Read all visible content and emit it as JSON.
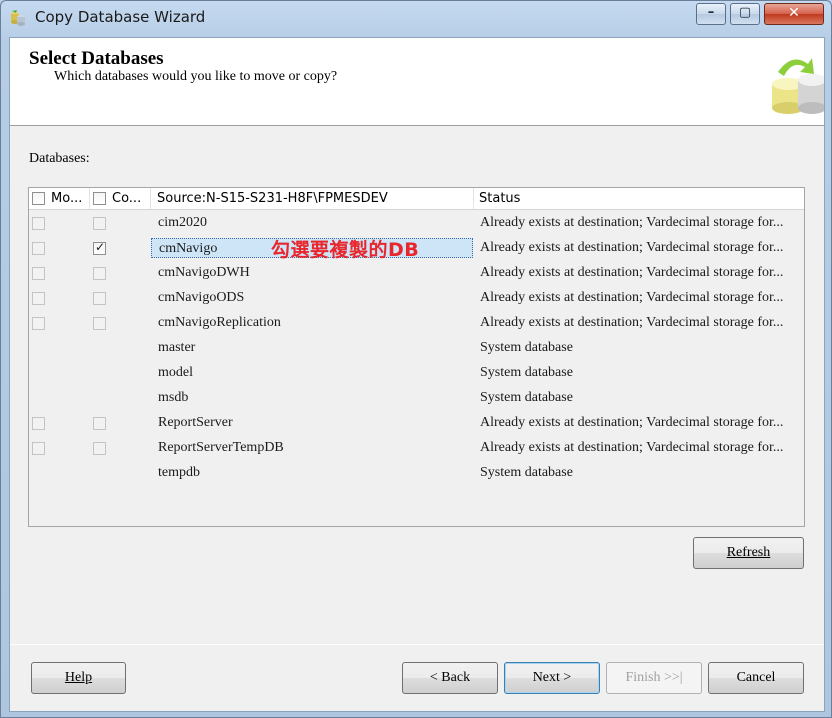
{
  "window": {
    "title": "Copy Database Wizard"
  },
  "header": {
    "title": "Select Databases",
    "subtitle": "Which databases would you like to move or copy?"
  },
  "databases_label": "Databases:",
  "grid": {
    "columns": [
      "Mo...",
      "Co...",
      "Source:N-S15-S231-H8F\\FPMESDEV",
      "Status"
    ],
    "rows": [
      {
        "move": false,
        "copy": false,
        "has_checks": true,
        "name": "cim2020",
        "status": "Already exists at destination; Vardecimal storage for..."
      },
      {
        "move": false,
        "copy": true,
        "has_checks": true,
        "selected": true,
        "name": "cmNavigo",
        "status": "Already exists at destination; Vardecimal storage for..."
      },
      {
        "move": false,
        "copy": false,
        "has_checks": true,
        "name": "cmNavigoDWH",
        "status": "Already exists at destination; Vardecimal storage for..."
      },
      {
        "move": false,
        "copy": false,
        "has_checks": true,
        "name": "cmNavigoODS",
        "status": "Already exists at destination; Vardecimal storage for..."
      },
      {
        "move": false,
        "copy": false,
        "has_checks": true,
        "name": "cmNavigoReplication",
        "status": "Already exists at destination; Vardecimal storage for..."
      },
      {
        "has_checks": false,
        "name": "master",
        "status": "System database"
      },
      {
        "has_checks": false,
        "name": "model",
        "status": "System database"
      },
      {
        "has_checks": false,
        "name": "msdb",
        "status": "System database"
      },
      {
        "move": false,
        "copy": false,
        "has_checks": true,
        "name": "ReportServer",
        "status": "Already exists at destination; Vardecimal storage for..."
      },
      {
        "move": false,
        "copy": false,
        "has_checks": true,
        "name": "ReportServerTempDB",
        "status": "Already exists at destination; Vardecimal storage for..."
      },
      {
        "has_checks": false,
        "name": "tempdb",
        "status": "System database"
      }
    ],
    "annotation": "勾選要複製的DB"
  },
  "buttons": {
    "refresh": "Refresh",
    "help": "Help",
    "back": "< Back",
    "next": "Next >",
    "finish": "Finish >>|",
    "cancel": "Cancel"
  },
  "colors": {
    "annotation": "#e8262b",
    "selection": "#cde5f7"
  }
}
